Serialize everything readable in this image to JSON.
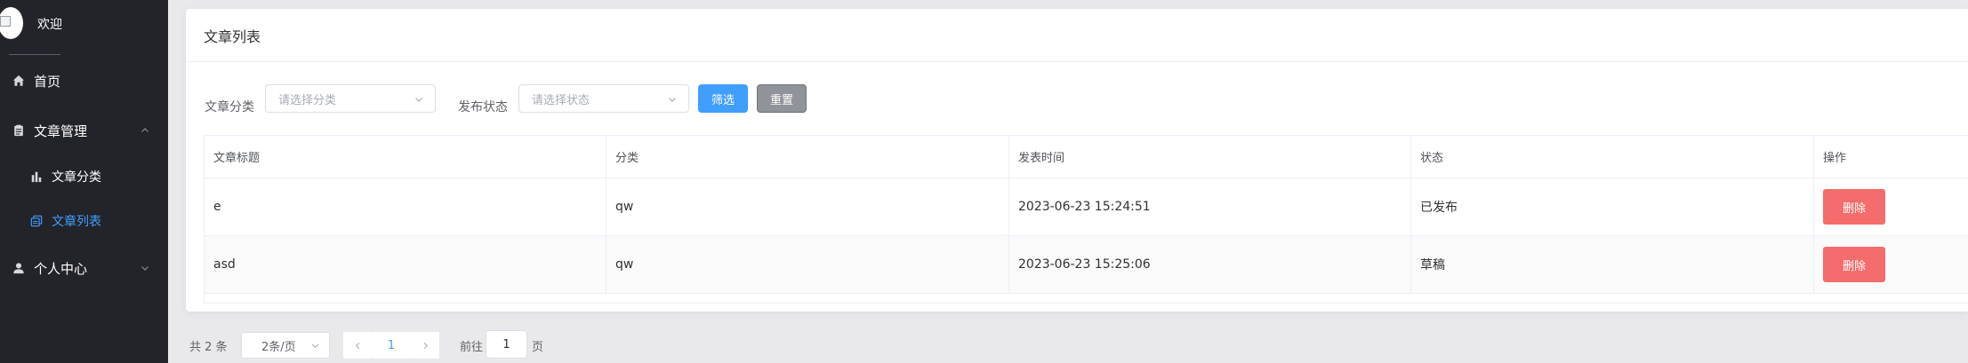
{
  "sidebar": {
    "welcome": "欢迎",
    "menu": [
      {
        "label": "首页",
        "icon": "home-icon"
      },
      {
        "label": "文章管理",
        "icon": "document-icon",
        "expanded": true
      },
      {
        "label": "个人中心",
        "icon": "user-icon",
        "expanded": false
      }
    ],
    "submenu": [
      {
        "label": "文章分类",
        "icon": "bar-chart-icon",
        "active": false
      },
      {
        "label": "文章列表",
        "icon": "copy-icon",
        "active": true
      }
    ]
  },
  "card": {
    "title": "文章列表"
  },
  "filters": {
    "category_label": "文章分类",
    "category_placeholder": "请选择分类",
    "status_label": "发布状态",
    "status_placeholder": "请选择状态",
    "filter_button": "筛选",
    "reset_button": "重置"
  },
  "table": {
    "headers": [
      "文章标题",
      "分类",
      "发表时间",
      "状态",
      "操作"
    ],
    "rows": [
      {
        "title": "e",
        "category": "qw",
        "time": "2023-06-23 15:24:51",
        "status": "已发布",
        "action": "删除"
      },
      {
        "title": "asd",
        "category": "qw",
        "time": "2023-06-23 15:25:06",
        "status": "草稿",
        "action": "删除"
      }
    ]
  },
  "pagination": {
    "total": "共 2 条",
    "page_size": "2条/页",
    "current_page": "1",
    "goto_label": "前往",
    "goto_value": "1",
    "page_unit": "页"
  },
  "colors": {
    "sidebar_bg": "#232429",
    "active": "#409eff",
    "danger": "#f56c6c",
    "info": "#909399"
  }
}
